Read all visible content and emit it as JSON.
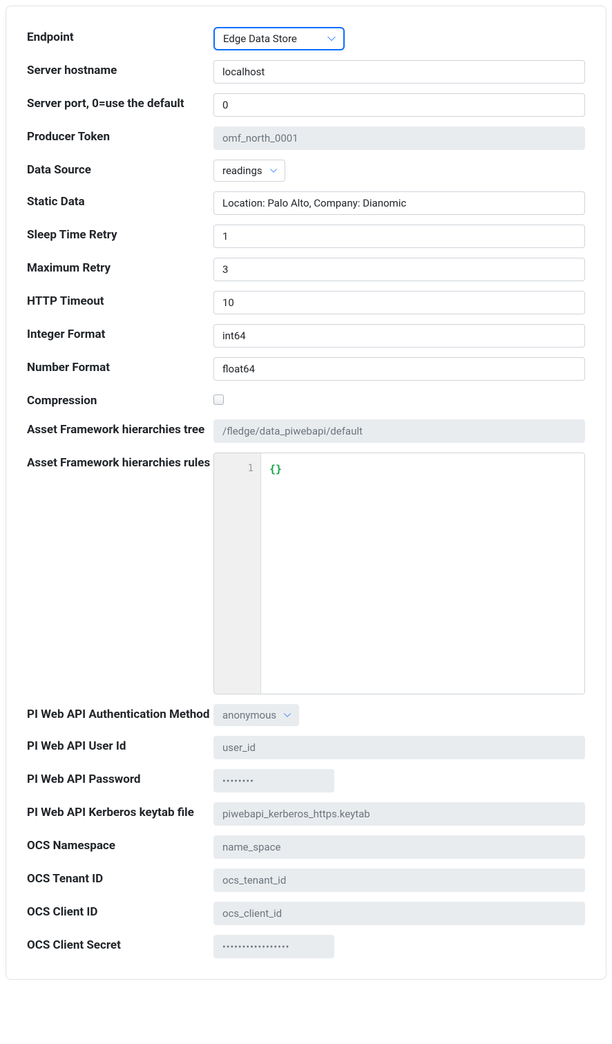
{
  "form": {
    "endpoint": {
      "label": "Endpoint",
      "value": "Edge Data Store"
    },
    "server_hostname": {
      "label": "Server hostname",
      "value": "localhost"
    },
    "server_port": {
      "label": "Server port, 0=use the default",
      "value": "0"
    },
    "producer_token": {
      "label": "Producer Token",
      "value": "omf_north_0001"
    },
    "data_source": {
      "label": "Data Source",
      "value": "readings"
    },
    "static_data": {
      "label": "Static Data",
      "value": "Location: Palo Alto, Company: Dianomic"
    },
    "sleep_time_retry": {
      "label": "Sleep Time Retry",
      "value": "1"
    },
    "maximum_retry": {
      "label": "Maximum Retry",
      "value": "3"
    },
    "http_timeout": {
      "label": "HTTP Timeout",
      "value": "10"
    },
    "integer_format": {
      "label": "Integer Format",
      "value": "int64"
    },
    "number_format": {
      "label": "Number Format",
      "value": "float64"
    },
    "compression": {
      "label": "Compression",
      "checked": false
    },
    "af_tree": {
      "label": "Asset Framework hierarchies tree",
      "value": "/fledge/data_piwebapi/default"
    },
    "af_rules": {
      "label": "Asset Framework hierarchies rules",
      "line_number": "1",
      "value": "{}"
    },
    "pi_auth_method": {
      "label": "PI Web API Authentication Method",
      "value": "anonymous"
    },
    "pi_user_id": {
      "label": "PI Web API User Id",
      "value": "user_id"
    },
    "pi_password": {
      "label": "PI Web API Password",
      "value": "••••••••"
    },
    "pi_kerberos": {
      "label": "PI Web API Kerberos keytab file",
      "value": "piwebapi_kerberos_https.keytab"
    },
    "ocs_namespace": {
      "label": "OCS Namespace",
      "value": "name_space"
    },
    "ocs_tenant_id": {
      "label": "OCS Tenant ID",
      "value": "ocs_tenant_id"
    },
    "ocs_client_id": {
      "label": "OCS Client ID",
      "value": "ocs_client_id"
    },
    "ocs_client_secret": {
      "label": "OCS Client Secret",
      "value": "•••••••••••••••••"
    }
  }
}
